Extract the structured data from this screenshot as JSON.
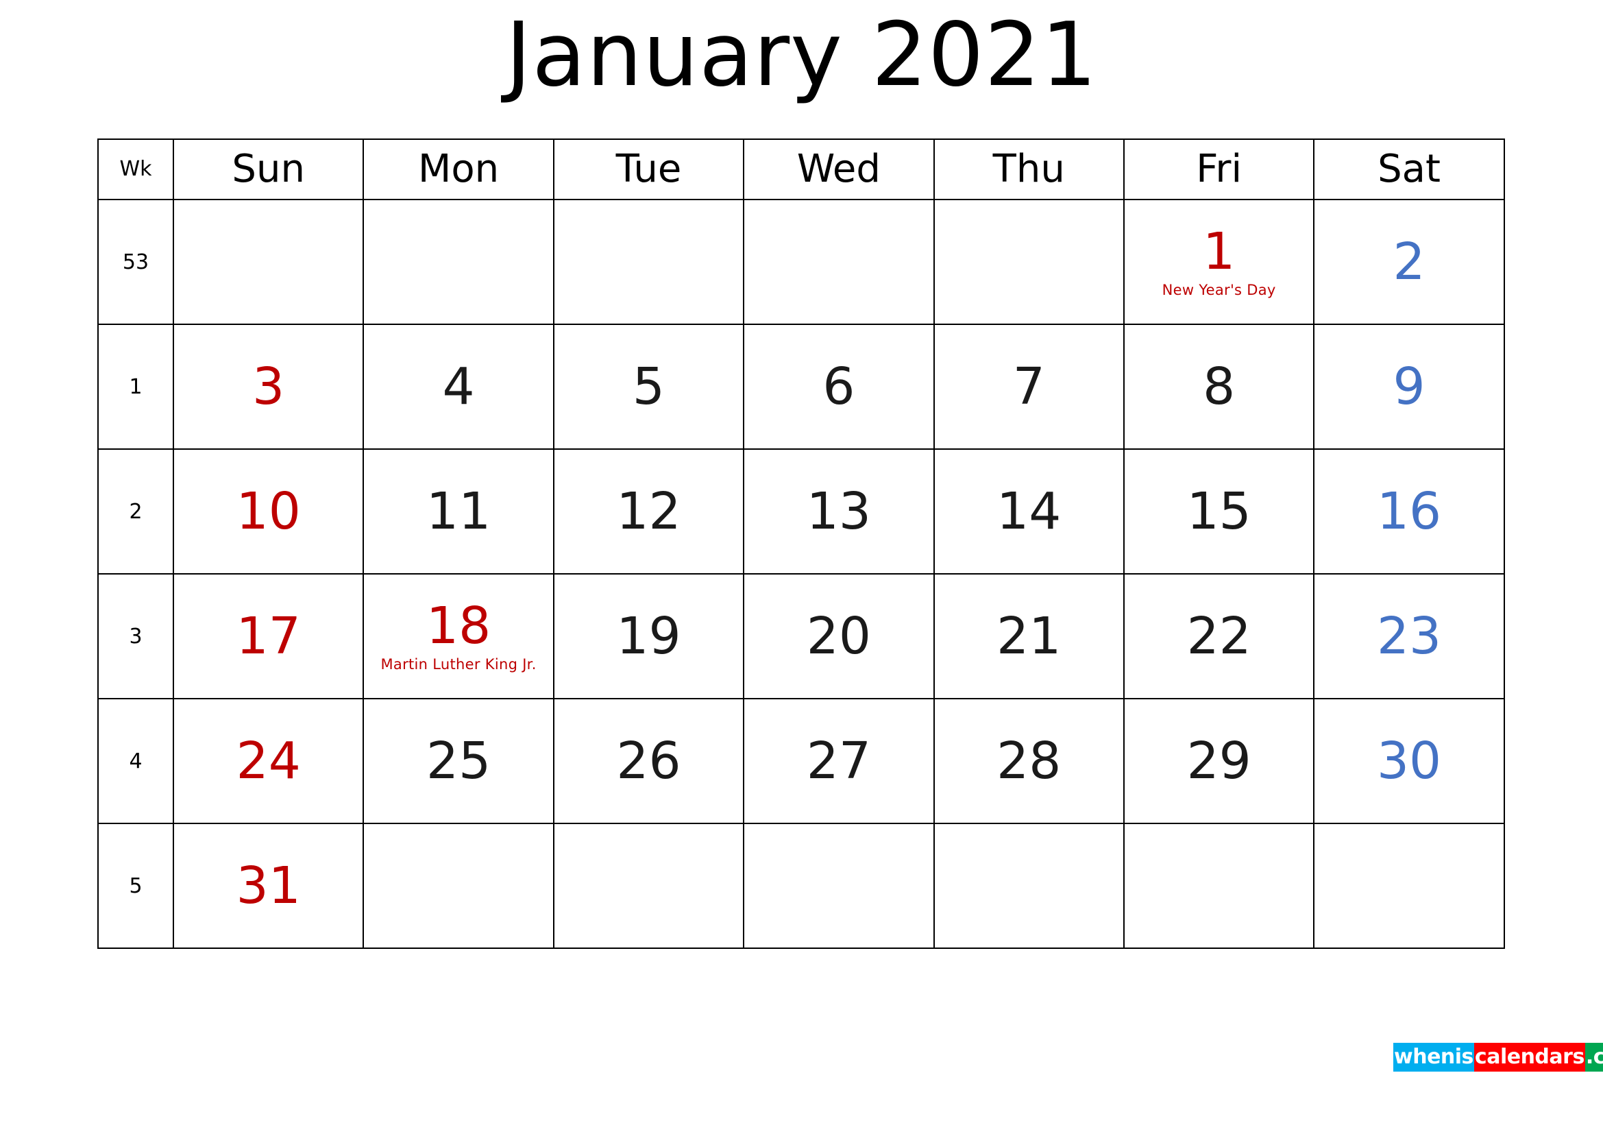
{
  "title": "January 2021",
  "colors": {
    "sunday": "#bd0000",
    "saturday": "#4472c4",
    "weekday": "#1a1a1a",
    "holiday": "#bd0000",
    "grid": "#000000",
    "logo_blue": "#00aeef",
    "logo_red": "#ff0000",
    "logo_green": "#00a651"
  },
  "headers": {
    "week": "Wk",
    "days": [
      "Sun",
      "Mon",
      "Tue",
      "Wed",
      "Thu",
      "Fri",
      "Sat"
    ]
  },
  "weeks": [
    {
      "wk": "53",
      "days": [
        {
          "num": "",
          "event": ""
        },
        {
          "num": "",
          "event": ""
        },
        {
          "num": "",
          "event": ""
        },
        {
          "num": "",
          "event": ""
        },
        {
          "num": "",
          "event": ""
        },
        {
          "num": "1",
          "event": "New Year's Day"
        },
        {
          "num": "2",
          "event": ""
        }
      ]
    },
    {
      "wk": "1",
      "days": [
        {
          "num": "3",
          "event": ""
        },
        {
          "num": "4",
          "event": ""
        },
        {
          "num": "5",
          "event": ""
        },
        {
          "num": "6",
          "event": ""
        },
        {
          "num": "7",
          "event": ""
        },
        {
          "num": "8",
          "event": ""
        },
        {
          "num": "9",
          "event": ""
        }
      ]
    },
    {
      "wk": "2",
      "days": [
        {
          "num": "10",
          "event": ""
        },
        {
          "num": "11",
          "event": ""
        },
        {
          "num": "12",
          "event": ""
        },
        {
          "num": "13",
          "event": ""
        },
        {
          "num": "14",
          "event": ""
        },
        {
          "num": "15",
          "event": ""
        },
        {
          "num": "16",
          "event": ""
        }
      ]
    },
    {
      "wk": "3",
      "days": [
        {
          "num": "17",
          "event": ""
        },
        {
          "num": "18",
          "event": "Martin Luther King Jr."
        },
        {
          "num": "19",
          "event": ""
        },
        {
          "num": "20",
          "event": ""
        },
        {
          "num": "21",
          "event": ""
        },
        {
          "num": "22",
          "event": ""
        },
        {
          "num": "23",
          "event": ""
        }
      ]
    },
    {
      "wk": "4",
      "days": [
        {
          "num": "24",
          "event": ""
        },
        {
          "num": "25",
          "event": ""
        },
        {
          "num": "26",
          "event": ""
        },
        {
          "num": "27",
          "event": ""
        },
        {
          "num": "28",
          "event": ""
        },
        {
          "num": "29",
          "event": ""
        },
        {
          "num": "30",
          "event": ""
        }
      ]
    },
    {
      "wk": "5",
      "days": [
        {
          "num": "31",
          "event": ""
        },
        {
          "num": "",
          "event": ""
        },
        {
          "num": "",
          "event": ""
        },
        {
          "num": "",
          "event": ""
        },
        {
          "num": "",
          "event": ""
        },
        {
          "num": "",
          "event": ""
        },
        {
          "num": "",
          "event": ""
        }
      ]
    }
  ],
  "logo": {
    "full_text": "wheniscalendars.com",
    "segments": [
      {
        "text": "whenis",
        "color": "#00aeef"
      },
      {
        "text": "calendars",
        "color": "#ff0000"
      },
      {
        "text": ".com",
        "color": "#00a651"
      }
    ]
  }
}
